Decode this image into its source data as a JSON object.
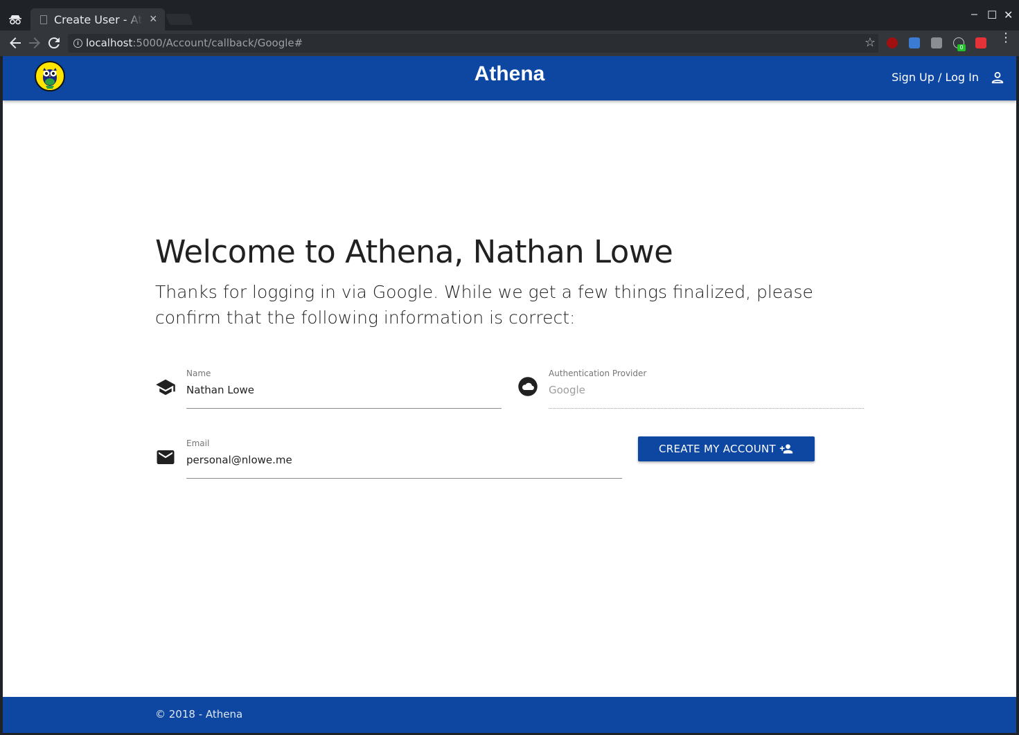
{
  "browser": {
    "tab_title": "Create User - Athena",
    "tab_close": "×",
    "url_host": "localhost",
    "url_rest": ":5000/Account/callback/Google#",
    "window_controls": [
      "–",
      "☐",
      "✕"
    ],
    "extensions": [
      "ublock-icon",
      "bitwarden-icon",
      "s-extension-icon",
      "cookie-extension-icon",
      "red-extension-icon"
    ],
    "extension_badge": "0"
  },
  "appbar": {
    "title": "Athena",
    "signup_label": "Sign Up / Log In"
  },
  "main": {
    "heading": "Welcome to Athena, Nathan Lowe",
    "subtitle": "Thanks for logging in via Google. While we get a few things finalized, please confirm that the following information is correct:",
    "name_field": {
      "label": "Name",
      "value": "Nathan Lowe"
    },
    "provider_field": {
      "label": "Authentication Provider",
      "value": "Google"
    },
    "email_field": {
      "label": "Email",
      "value": "personal@nlowe.me"
    },
    "create_button_label": "CREATE MY ACCOUNT"
  },
  "footer": {
    "text": "© 2018 - Athena"
  },
  "colors": {
    "brand": "#0d47a1",
    "chrome_dark": "#1f2226",
    "logo_yellow": "#ffe500"
  }
}
